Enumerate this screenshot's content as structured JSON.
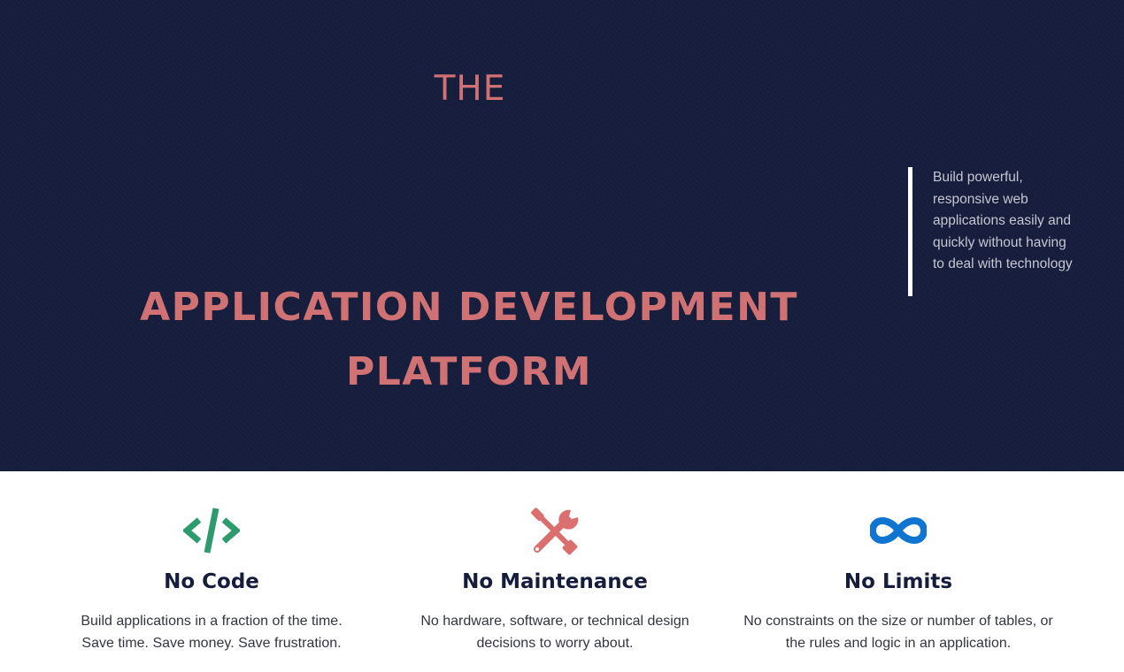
{
  "hero": {
    "the_label": "THE",
    "title_line1": "APPLICATION DEVELOPMENT",
    "title_line2": "PLATFORM",
    "tagline": "Build powerful, responsive web applications easily and quickly without having to deal with technology"
  },
  "features": [
    {
      "icon": "code-icon",
      "icon_color": "#2e9b6e",
      "title": "No Code",
      "desc_line1": "Build applications in a fraction of the time.",
      "desc_line2": "Save time. Save money. Save frustration."
    },
    {
      "icon": "tools-icon",
      "icon_color": "#d9706f",
      "title": "No Maintenance",
      "desc_line1": "No hardware, software, or technical design",
      "desc_line2": "decisions to worry about."
    },
    {
      "icon": "infinity-icon",
      "icon_color": "#1075d0",
      "title": "No Limits",
      "desc_line1": "No constraints on the size or number of tables, or",
      "desc_line2": "the rules and logic in an application."
    }
  ],
  "colors": {
    "hero_background": "#161d3c",
    "accent": "#d07173",
    "tagline_text": "#c4c7d2"
  }
}
